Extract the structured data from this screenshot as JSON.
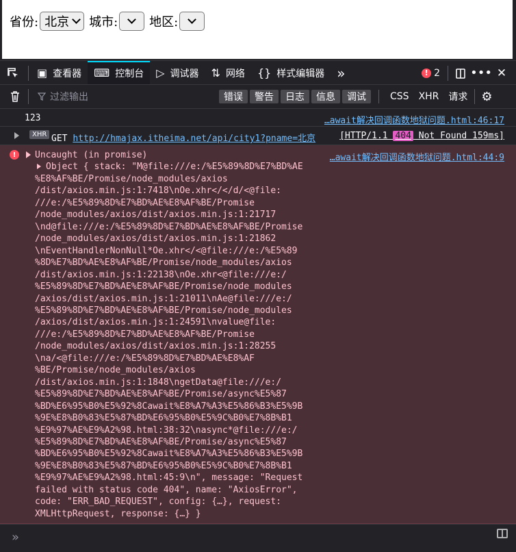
{
  "page": {
    "province_label": "省份:",
    "province_value": "北京",
    "city_label": "城市:",
    "district_label": "地区:"
  },
  "toolbar": {
    "tabs": [
      {
        "label": "查看器",
        "icon": "inspector-icon"
      },
      {
        "label": "控制台",
        "icon": "console-icon"
      },
      {
        "label": "调试器",
        "icon": "debugger-icon"
      },
      {
        "label": "网络",
        "icon": "network-icon"
      },
      {
        "label": "样式编辑器",
        "icon": "style-editor-icon"
      }
    ],
    "more": "»",
    "error_count": "2"
  },
  "filterbar": {
    "placeholder": "过滤输出",
    "levels": [
      "错误",
      "警告",
      "日志",
      "信息",
      "调试"
    ],
    "categories": [
      "CSS",
      "XHR",
      "请求"
    ]
  },
  "console": {
    "log_message": "123",
    "log_source": "…await解决回调函数地狱问题.html:46:17",
    "net_tag": "XHR",
    "net_method": "GET",
    "net_url": "http://hmajax.itheima.net/api/city1?pname=北京",
    "net_status_prefix": "[HTTP/1.1 ",
    "net_status_code": "404",
    "net_status_suffix": " Not Found 159ms]",
    "error_title": "Uncaught (in promise)",
    "error_source": "…await解决回调函数地狱问题.html:44:9",
    "error_object": "Object { stack: \"M@file:///e:/%E5%89%8D%E7%BD%AE",
    "error_stack_lines": [
      "%E8%AF%BE/Promise/node_modules/axios",
      "/dist/axios.min.js:1:7418\\nOe.xhr</</d/<@file:",
      "///e:/%E5%89%8D%E7%BD%AE%E8%AF%BE/Promise",
      "/node_modules/axios/dist/axios.min.js:1:21717",
      "\\nd@file:///e:/%E5%89%8D%E7%BD%AE%E8%AF%BE/Promise",
      "/node_modules/axios/dist/axios.min.js:1:21862",
      "\\nEventHandlerNonNull*Oe.xhr</<@file:///e:/%E5%89",
      "%8D%E7%BD%AE%E8%AF%BE/Promise/node_modules/axios",
      "/dist/axios.min.js:1:22138\\nOe.xhr<@file:///e:/",
      "%E5%89%8D%E7%BD%AE%E8%AF%BE/Promise/node_modules",
      "/axios/dist/axios.min.js:1:21011\\nAe@file:///e:/",
      "%E5%89%8D%E7%BD%AE%E8%AF%BE/Promise/node_modules",
      "/axios/dist/axios.min.js:1:24591\\nvalue@file:",
      "///e:/%E5%89%8D%E7%BD%AE%E8%AF%BE/Promise",
      "/node_modules/axios/dist/axios.min.js:1:28255",
      "\\na/<@file:///e:/%E5%89%8D%E7%BD%AE%E8%AF",
      "%BE/Promise/node_modules/axios",
      "/dist/axios.min.js:1:1848\\ngetData@file:///e:/",
      "%E5%89%8D%E7%BD%AE%E8%AF%BE/Promise/async%E5%87",
      "%BD%E6%95%B0%E5%92%8Cawait%E8%A7%A3%E5%86%B3%E5%9B",
      "%9E%E8%B0%83%E5%87%BD%E6%95%B0%E5%9C%B0%E7%8B%B1",
      "%E9%97%AE%E9%A2%98.html:38:32\\nasync*@file:///e:/",
      "%E5%89%8D%E7%BD%AE%E8%AF%BE/Promise/async%E5%87",
      "%BD%E6%95%B0%E5%92%8Cawait%E8%A7%A3%E5%86%B3%E5%9B",
      "%9E%E8%B0%83%E5%87%BD%E6%95%B0%E5%9C%B0%E7%8B%B1",
      "%E9%97%AE%E9%A2%98.html:45:9\\n\", message: \"Request",
      "failed with status code 404\", name: \"AxiosError\",",
      "code: \"ERR_BAD_REQUEST\", config: {…}, request:",
      "XMLHttpRequest, response: {…} }"
    ],
    "prompt": "»"
  },
  "colors": {
    "accent": "#00ddff",
    "error": "#ff4f5e",
    "error_bg": "#4b2f36",
    "link": "#75bfff",
    "badge404": "#e35cc4"
  }
}
